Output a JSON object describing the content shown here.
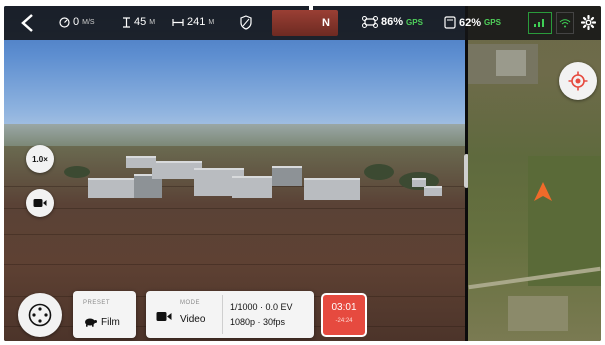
{
  "topbar": {
    "speed": "0",
    "speed_unit": "M/S",
    "altitude": "45",
    "altitude_unit": "M",
    "distance": "241",
    "distance_unit": "M",
    "heading": "N",
    "drone_battery": "86%",
    "drone_gps": "GPS",
    "device_battery": "62%",
    "device_gps": "GPS"
  },
  "controls": {
    "zoom_label": "1.0×"
  },
  "preset": {
    "caption": "PRESET",
    "value": "Film"
  },
  "mode": {
    "caption": "MODE",
    "value": "Video",
    "exposure": "1/1000 · 0.0 EV",
    "resolution": "1080p · 30fps"
  },
  "recording": {
    "elapsed": "03:01",
    "remaining": "-24:24"
  },
  "colors": {
    "record_red": "#e64a3f",
    "gps_green": "#4fd05a",
    "drone_arrow": "#f06a2a"
  }
}
